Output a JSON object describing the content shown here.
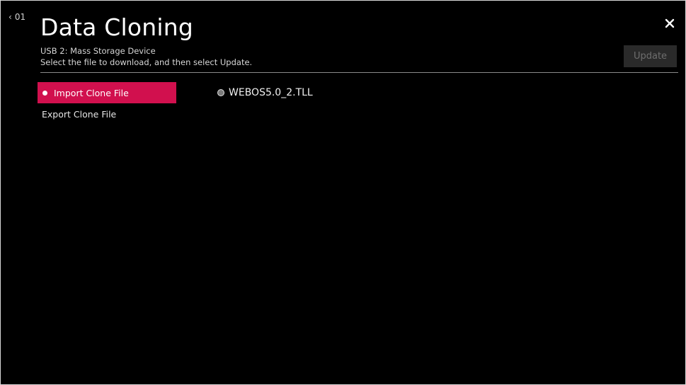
{
  "header": {
    "back_label": "01",
    "title": "Data Cloning",
    "subtitle_line1": "USB 2: Mass Storage Device",
    "subtitle_line2": "Select the file to download, and then select Update.",
    "update_label": "Update"
  },
  "menu": {
    "items": [
      {
        "label": "Import Clone File",
        "selected": true
      },
      {
        "label": "Export Clone File",
        "selected": false
      }
    ]
  },
  "files": [
    {
      "name": "WEBOS5.0_2.TLL",
      "selected": false
    }
  ],
  "colors": {
    "background": "#000000",
    "accent": "#d1104e",
    "update_disabled_bg": "#2a2a2a",
    "update_disabled_text": "#6e6e6e"
  },
  "icons": {
    "back": "chevron-left-icon",
    "close": "close-icon",
    "selected_marker": "dot-icon",
    "file_marker": "radio-icon"
  }
}
